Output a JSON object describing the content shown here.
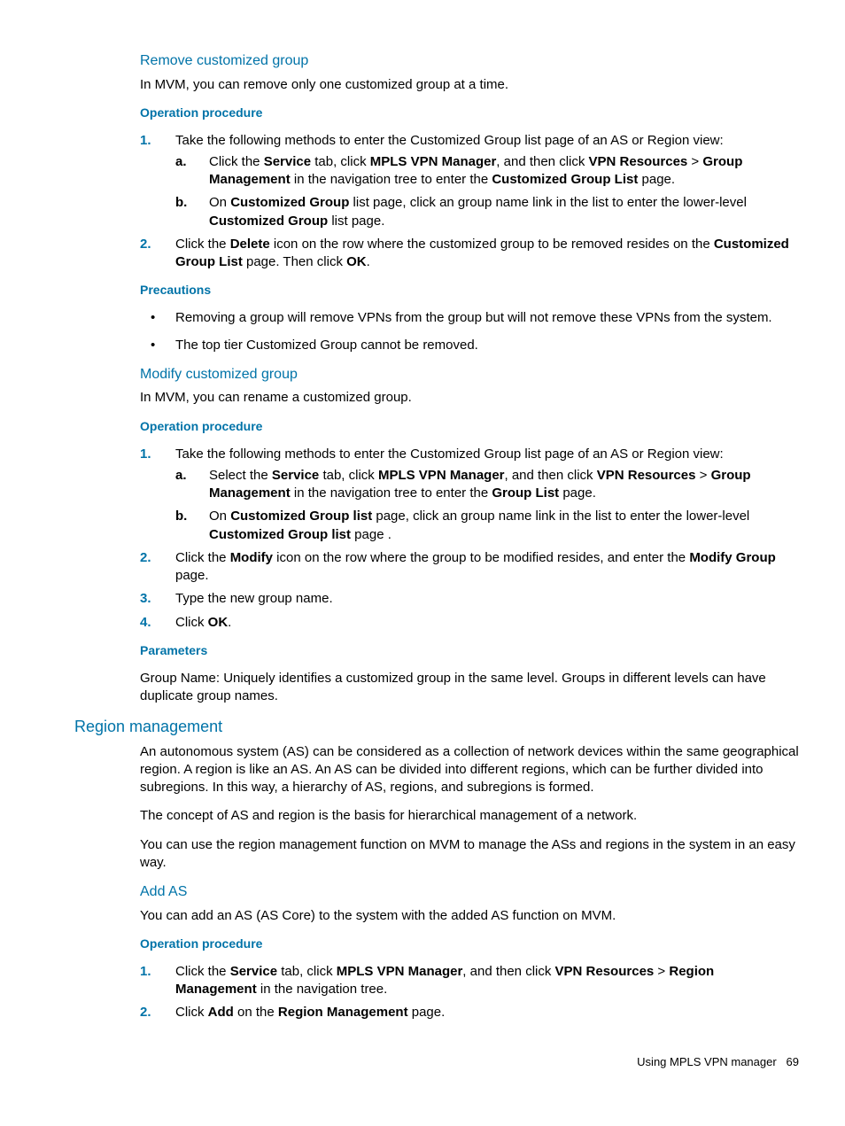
{
  "s1": {
    "heading": "Remove customized group",
    "intro": "In MVM, you can remove only one customized group at a time.",
    "opHeading": "Operation procedure",
    "step1_lead": "Take the following methods to enter the Customized Group list page of an AS or Region view:",
    "step1a_pre": "Click the ",
    "step1a_b1": "Service",
    "step1a_t1": " tab, click ",
    "step1a_b2": "MPLS VPN Manager",
    "step1a_t2": ", and then click ",
    "step1a_b3": "VPN Resources",
    "step1a_gt": " > ",
    "step1a_b4": "Group Management",
    "step1a_t3": " in the navigation tree to enter the ",
    "step1a_b5": "Customized Group List",
    "step1a_t4": " page.",
    "step1b_t1": "On ",
    "step1b_b1": "Customized Group",
    "step1b_t2": " list page, click an group name link in the list to enter the lower-level ",
    "step1b_b2": "Customized Group",
    "step1b_t3": " list page.",
    "step2_t1": "Click the ",
    "step2_b1": "Delete",
    "step2_t2": " icon on the row where the customized group to be removed resides on the ",
    "step2_b2": "Customized Group List",
    "step2_t3": " page. Then click ",
    "step2_b3": "OK",
    "step2_t4": ".",
    "precHeading": "Precautions",
    "prec1": "Removing a group will remove VPNs from the group but will not remove these VPNs from the system.",
    "prec2": "The top tier Customized Group cannot be removed."
  },
  "s2": {
    "heading": "Modify customized group",
    "intro": "In MVM, you can rename a customized group.",
    "opHeading": "Operation procedure",
    "step1_lead": "Take the following methods to enter the Customized Group list page of an AS or Region view:",
    "step1a_pre": "Select the ",
    "step1a_b1": "Service",
    "step1a_t1": " tab, click ",
    "step1a_b2": "MPLS VPN Manager",
    "step1a_t2": ", and then click ",
    "step1a_b3": "VPN Resources",
    "step1a_gt": " > ",
    "step1a_b4": "Group Management",
    "step1a_t3": " in the navigation tree to enter the ",
    "step1a_b5": "Group List",
    "step1a_t4": " page.",
    "step1b_t1": "On ",
    "step1b_b1": "Customized Group list",
    "step1b_t2": " page, click an group name link in the list to enter the lower-level ",
    "step1b_b2": "Customized Group list",
    "step1b_t3": " page .",
    "step2_t1": "Click the ",
    "step2_b1": "Modify",
    "step2_t2": " icon on the row where the group to be modified resides, and enter the ",
    "step2_b2": "Modify Group",
    "step2_t3": " page.",
    "step3": "Type the new group name.",
    "step4_t1": "Click ",
    "step4_b1": "OK",
    "step4_t2": ".",
    "paramHeading": "Parameters",
    "paramText": "Group Name: Uniquely identifies a customized group in the same level. Groups in different levels can have duplicate group names."
  },
  "s3": {
    "heading": "Region management",
    "p1": "An autonomous system (AS) can be considered as a collection of network devices within the same geographical region. A region is like an AS. An AS can be divided into different regions, which can be further divided into subregions. In this way, a hierarchy of AS, regions, and subregions is formed.",
    "p2": "The concept of AS and region is the basis for hierarchical management of a network.",
    "p3": "You can use the region management function on MVM to manage the ASs and regions in the system in an easy way."
  },
  "s4": {
    "heading": "Add AS",
    "intro": "You can add an AS (AS Core) to the system with the added AS function on MVM.",
    "opHeading": "Operation procedure",
    "step1_t1": "Click the ",
    "step1_b1": "Service",
    "step1_t2": " tab, click ",
    "step1_b2": "MPLS VPN Manager",
    "step1_t3": ", and then click ",
    "step1_b3": "VPN Resources",
    "step1_gt": " > ",
    "step1_b4": "Region Management",
    "step1_t4": " in the navigation tree.",
    "step2_t1": "Click ",
    "step2_b1": "Add",
    "step2_t2": " on the ",
    "step2_b2": "Region Management",
    "step2_t3": " page."
  },
  "footer": {
    "text": "Using MPLS VPN manager",
    "page": "69"
  },
  "markers": {
    "m1": "1.",
    "m2": "2.",
    "m3": "3.",
    "m4": "4.",
    "ma": "a.",
    "mb": "b."
  }
}
